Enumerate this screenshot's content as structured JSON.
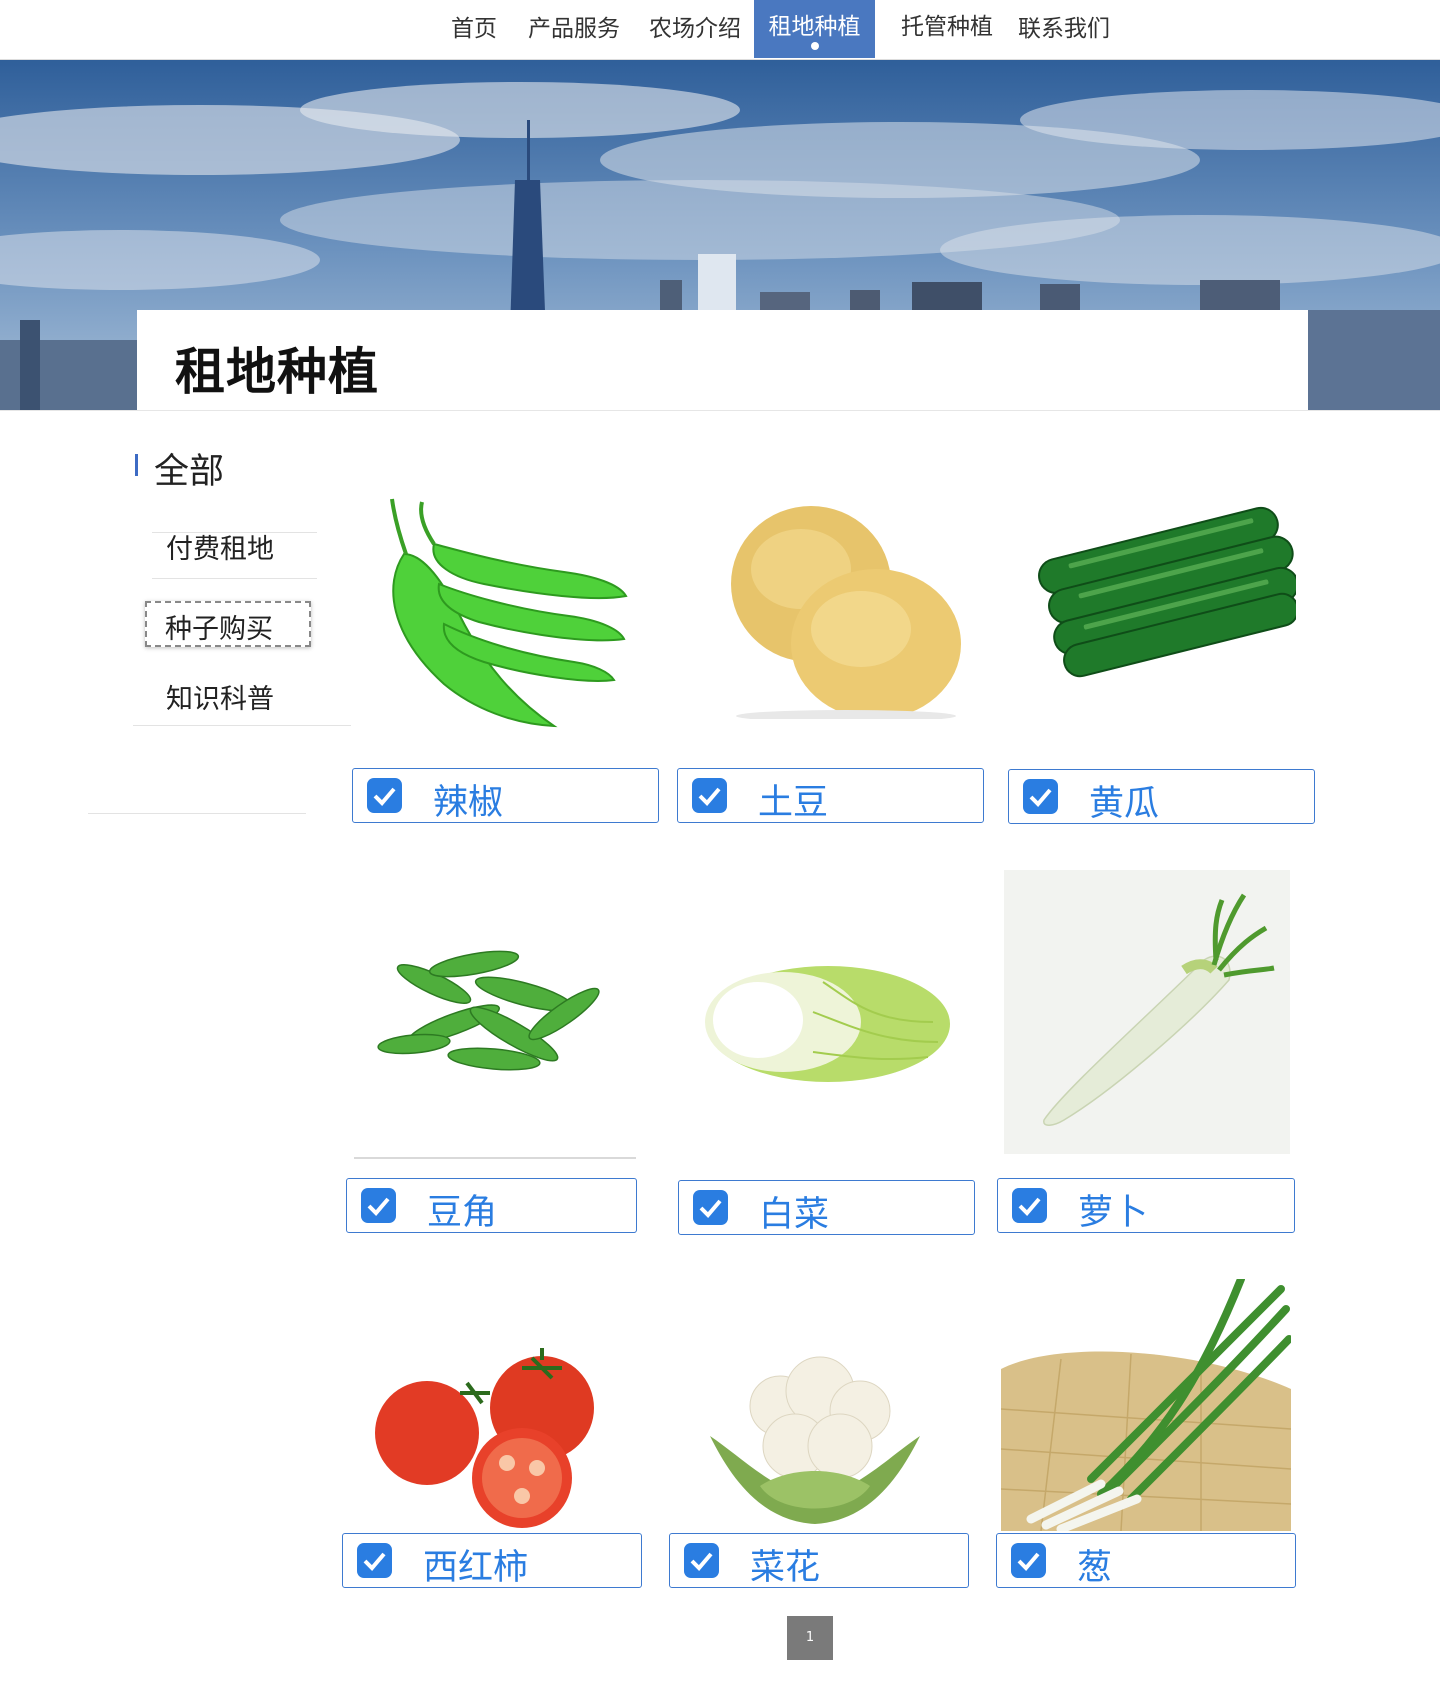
{
  "nav": {
    "items": [
      {
        "label": "首页"
      },
      {
        "label": "产品服务"
      },
      {
        "label": "农场介绍"
      },
      {
        "label": "租地种植"
      },
      {
        "label": "托管种植"
      },
      {
        "label": "联系我们"
      }
    ],
    "active_index": 3,
    "active_color": "#4a78c0"
  },
  "banner": {
    "title": "租地种植"
  },
  "sidebar": {
    "heading": "全部",
    "items": [
      {
        "label": "付费租地"
      },
      {
        "label": "种子购买"
      },
      {
        "label": "知识科普"
      }
    ],
    "selected_index": 1
  },
  "products": [
    {
      "name": "辣椒",
      "checked": true,
      "icon": "chili-pepper-image"
    },
    {
      "name": "土豆",
      "checked": true,
      "icon": "potato-image"
    },
    {
      "name": "黄瓜",
      "checked": true,
      "icon": "cucumber-image"
    },
    {
      "name": "豆角",
      "checked": true,
      "icon": "snow-pea-image"
    },
    {
      "name": "白菜",
      "checked": true,
      "icon": "cabbage-image"
    },
    {
      "name": "萝卜",
      "checked": true,
      "icon": "radish-image"
    },
    {
      "name": "西红柿",
      "checked": true,
      "icon": "tomato-image"
    },
    {
      "name": "菜花",
      "checked": true,
      "icon": "cauliflower-image"
    },
    {
      "name": "葱",
      "checked": true,
      "icon": "scallion-image"
    }
  ],
  "pagination": {
    "current_page": "1"
  },
  "colors": {
    "accent_blue": "#2a7de1",
    "nav_active": "#4a78c0",
    "pager_bg": "#7a7a7a"
  }
}
